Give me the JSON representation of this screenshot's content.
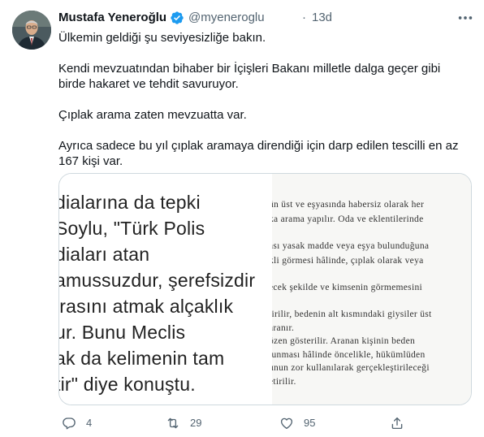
{
  "tweet": {
    "author": {
      "display_name": "Mustafa Yeneroğlu",
      "handle": "@myeneroglu",
      "verified": true,
      "avatar_icon": "profile-photo"
    },
    "separator": "·",
    "timestamp": "13d",
    "more_icon": "more-horizontal-icon",
    "paragraphs": [
      "Ülkemin geldiği şu seviyesizliğe bakın.",
      "Kendi mevzuatından bihaber bir İçişleri Bakanı milletle dalga geçer gibi birde hakaret ve tehdit savuruyor.",
      "Çıplak arama zaten mevzuatta var.",
      "Ayrıca sadece bu yıl çıplak aramaya direndiği için darp edilen tescilli en az 167 kişi var."
    ],
    "media": {
      "left_lines": [
        "dialarına da tepki",
        "Soylu, \"Türk Polis",
        "diaları atan",
        "amussuzdur, şerefsizdir",
        "irasını atmak alçaklık",
        "ur. Bunu Meclis",
        "ak da kelimenin tam",
        "tir\" diye konuştu."
      ],
      "right_lines": [
        "ün üst ve eşyasında habersiz olarak her",
        "ka arama yapılır. Oda ve eklentilerinde",
        "ası yasak madde veya eşya bulunduğuna",
        "kli görmesi hâlinde, çıplak olarak veya",
        "ecek şekilde ve kimsenin görmemesini",
        "tirilir, bedenin alt kısmındaki giysiler üst",
        "aranır.",
        "özen gösterilir. Aranan kişinin beden",
        "lunması hâlinde öncelikle, hükümlüden",
        "unun zor kullanılarak gerçekleştirileceği",
        "etirilir."
      ]
    },
    "actions": {
      "reply": {
        "icon": "reply-icon",
        "count": "4"
      },
      "retweet": {
        "icon": "retweet-icon",
        "count": "29"
      },
      "like": {
        "icon": "heart-icon",
        "count": "95"
      },
      "share": {
        "icon": "share-icon"
      }
    },
    "colors": {
      "text": "#0f1419",
      "secondary": "#536471",
      "verified": "#1d9bf0",
      "border": "#cfd9de"
    }
  }
}
